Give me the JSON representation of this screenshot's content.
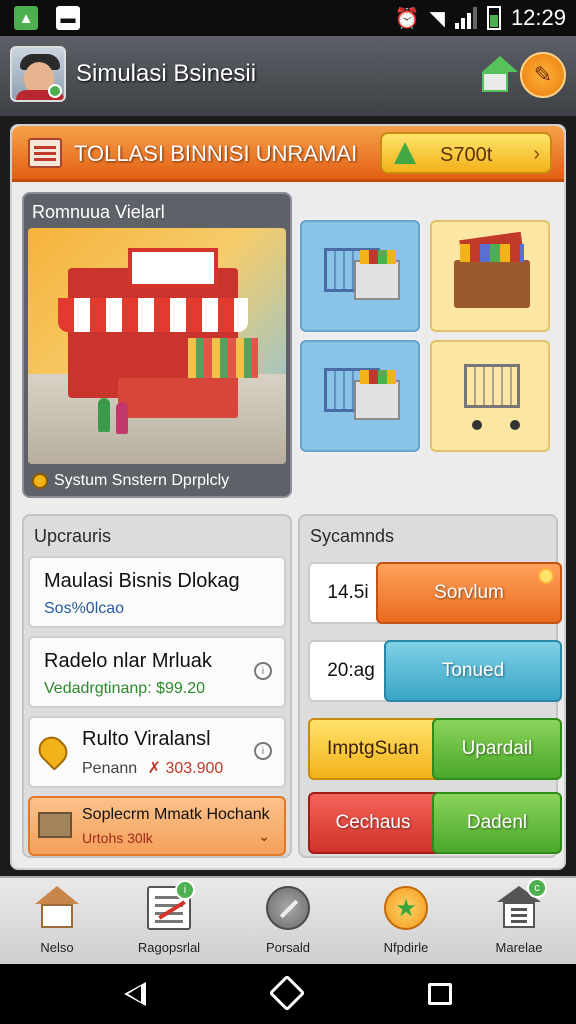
{
  "status_bar": {
    "time": "12:29"
  },
  "app": {
    "title": "Simulasi Bsinesii"
  },
  "banner": {
    "title": "TOLLASI BINNISI UNRAMAI",
    "currency": "S700t",
    "currency_arrow": "›"
  },
  "showcase": {
    "title": "Romnuua Vielarl",
    "footer": "Systum Snstern Dprplcly"
  },
  "left_panel": {
    "title": "Upcrauris",
    "cards": [
      {
        "title": "Maulasi Bisnis Dlokag",
        "subtitle": "Sos%0lcao",
        "subtitle_color": "#2a5a9a"
      },
      {
        "title": "Radelo nlar Mrluak",
        "subtitle": "Vedadrgtinanp: $99.20",
        "subtitle_color": "#2d8a2d"
      },
      {
        "title": "Rulto Viralansl",
        "subtitle_prefix": "Penann",
        "subtitle_price": "✗ 303.900",
        "subtitle_color": "#c0392b"
      },
      {
        "title": "Soplecrm Mmatk Hochank",
        "subtitle": "Urtohs 30lk",
        "subtitle_color": "#a12a1a"
      }
    ]
  },
  "right_panel": {
    "title": "Sycamnds",
    "rows": [
      {
        "value": "14.5i",
        "button": "Sorvlum"
      },
      {
        "value": "20:ag",
        "button": "Tonued"
      },
      {
        "value": "ImptgSuan",
        "button": "Upardail"
      },
      {
        "value": "Cechaus",
        "button": "Dadenl"
      }
    ]
  },
  "bottom_nav": [
    {
      "label": "Nelso",
      "icon": "house-icon"
    },
    {
      "label": "Ragopsrlal",
      "icon": "chart-icon",
      "badge": "i"
    },
    {
      "label": "Porsald",
      "icon": "wrench-icon"
    },
    {
      "label": "Nfpdirle",
      "icon": "star-icon"
    },
    {
      "label": "Marelae",
      "icon": "document-icon",
      "badge": "c"
    }
  ]
}
